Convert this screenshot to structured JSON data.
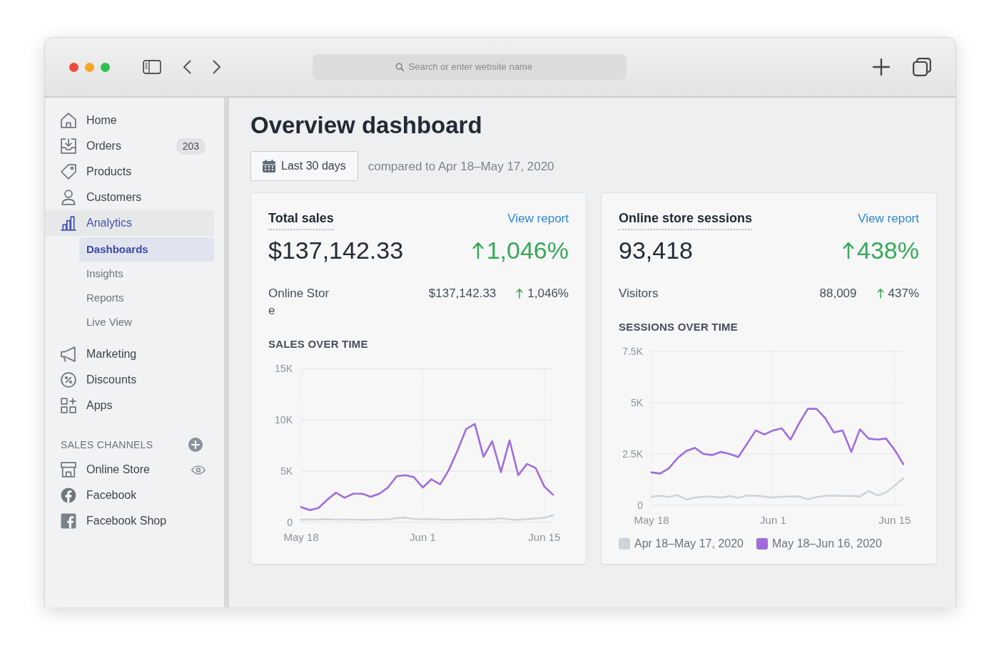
{
  "browser": {
    "address_bar": {
      "placeholder": "Search or enter website name"
    }
  },
  "sidebar": {
    "items": [
      {
        "label": "Home",
        "selected": false
      },
      {
        "label": "Orders",
        "badge": "203",
        "selected": false
      },
      {
        "label": "Products",
        "selected": false
      },
      {
        "label": "Customers",
        "selected": false
      },
      {
        "label": "Analytics",
        "selected": true,
        "children": [
          {
            "label": "Dashboards",
            "selected": true
          },
          {
            "label": "Insights",
            "selected": false
          },
          {
            "label": "Reports",
            "selected": false
          },
          {
            "label": "Live View",
            "selected": false
          }
        ]
      },
      {
        "label": "Marketing",
        "selected": false
      },
      {
        "label": "Discounts",
        "selected": false
      },
      {
        "label": "Apps",
        "selected": false
      }
    ],
    "sales_channels": {
      "heading": "SALES CHANNELS",
      "items": [
        {
          "label": "Online Store",
          "selected": false
        },
        {
          "label": "Facebook",
          "selected": false
        },
        {
          "label": "Facebook Shop",
          "selected": false
        }
      ]
    }
  },
  "page": {
    "title": "Overview dashboard",
    "date_button": "Last 30 days",
    "comparison": "compared to Apr 18–May 17, 2020"
  },
  "cards": [
    {
      "title": "Total sales",
      "link": "View report",
      "value": "$137,142.33",
      "change": "1,046%",
      "breakdown": [
        {
          "label": "Online Store",
          "value": "$137,142.33",
          "change": "1,046%"
        }
      ],
      "chart_data": {
        "type": "line",
        "title": "SALES OVER TIME",
        "categories": [
          "May 18",
          null,
          null,
          null,
          null,
          null,
          null,
          null,
          null,
          null,
          null,
          null,
          null,
          null,
          "Jun 1",
          null,
          null,
          null,
          null,
          null,
          null,
          null,
          null,
          null,
          null,
          null,
          null,
          null,
          "Jun 15",
          null
        ],
        "ylim": [
          0,
          15000
        ],
        "yticks": [
          {
            "value": 0,
            "label": "0"
          },
          {
            "value": 5000,
            "label": "5K"
          },
          {
            "value": 10000,
            "label": "10K"
          },
          {
            "value": 15000,
            "label": "15K"
          }
        ],
        "grid": true,
        "series": [
          {
            "color": "#cfd4d9",
            "values": [
              250,
              300,
              280,
              320,
              260,
              300,
              280,
              250,
              260,
              280,
              300,
              420,
              460,
              350,
              300,
              330,
              280,
              260,
              280,
              300,
              290,
              280,
              320,
              420,
              300,
              250,
              320,
              380,
              450,
              700
            ]
          },
          {
            "color": "#a06cdb",
            "values": [
              1500,
              1200,
              1400,
              2200,
              2900,
              2400,
              2800,
              2800,
              2500,
              2800,
              3400,
              4500,
              4600,
              4400,
              3400,
              4200,
              3700,
              5100,
              7000,
              9100,
              9600,
              6400,
              7900,
              4900,
              8000,
              4600,
              5700,
              5300,
              3500,
              2700
            ]
          }
        ]
      }
    },
    {
      "title": "Online store sessions",
      "link": "View report",
      "value": "93,418",
      "change": "438%",
      "breakdown": [
        {
          "label": "Visitors",
          "value": "88,009",
          "change": "437%"
        }
      ],
      "chart_data": {
        "type": "line",
        "title": "SESSIONS OVER TIME",
        "categories": [
          "May 18",
          null,
          null,
          null,
          null,
          null,
          null,
          null,
          null,
          null,
          null,
          null,
          null,
          null,
          "Jun 1",
          null,
          null,
          null,
          null,
          null,
          null,
          null,
          null,
          null,
          null,
          null,
          null,
          null,
          "Jun 15",
          null
        ],
        "ylim": [
          0,
          7500
        ],
        "yticks": [
          {
            "value": 0,
            "label": "0"
          },
          {
            "value": 2500,
            "label": "2.5K"
          },
          {
            "value": 5000,
            "label": "5K"
          },
          {
            "value": 7500,
            "label": "7.5K"
          }
        ],
        "grid": true,
        "series": [
          {
            "name": "Apr 18–May 17, 2020",
            "color": "#cfd4d9",
            "values": [
              420,
              470,
              400,
              500,
              280,
              380,
              420,
              420,
              380,
              450,
              360,
              480,
              470,
              420,
              380,
              420,
              430,
              430,
              300,
              400,
              460,
              480,
              460,
              460,
              430,
              700,
              480,
              620,
              950,
              1320
            ]
          },
          {
            "name": "May 18–Jun 16, 2020",
            "color": "#a06cdb",
            "values": [
              1600,
              1550,
              1800,
              2300,
              2650,
              2800,
              2500,
              2450,
              2600,
              2500,
              2350,
              3000,
              3650,
              3450,
              3650,
              3750,
              3200,
              4000,
              4700,
              4700,
              4250,
              3550,
              3650,
              2600,
              3700,
              3250,
              3200,
              3250,
              2700,
              2000
            ]
          }
        ]
      }
    }
  ]
}
